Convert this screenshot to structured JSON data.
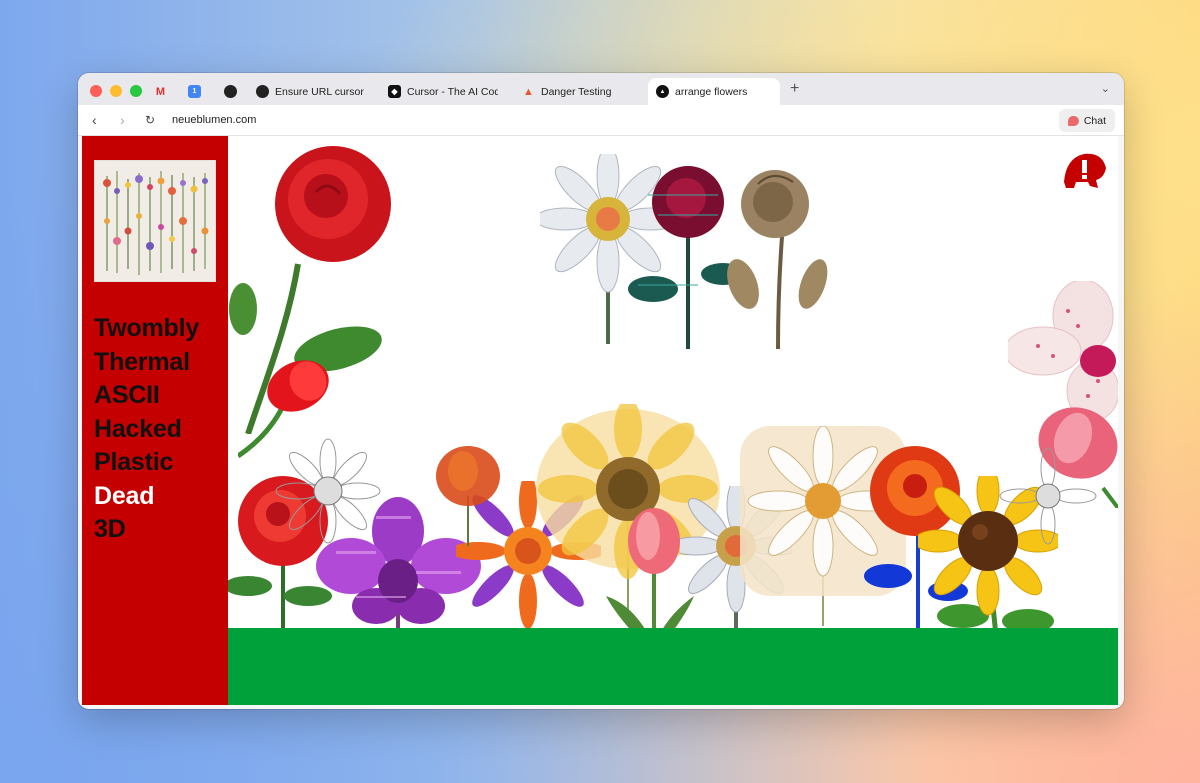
{
  "browser": {
    "tabs": [
      {
        "title": "",
        "favicon": "gmail-icon"
      },
      {
        "title": "",
        "favicon": "calendar-icon"
      },
      {
        "title": "",
        "favicon": "github-icon"
      },
      {
        "title": "Ensure URL cursor stay",
        "favicon": "github-icon"
      },
      {
        "title": "Cursor - The AI Code E",
        "favicon": "cursor-icon"
      },
      {
        "title": "Danger Testing",
        "favicon": "danger-icon"
      },
      {
        "title": "arrange flowers",
        "favicon": "triangle-icon",
        "active": true
      }
    ],
    "new_tab": "+",
    "tab_menu": "⌄",
    "url": "neueblumen.com",
    "chat_label": "Chat"
  },
  "page": {
    "menu": [
      {
        "label": "Twombly"
      },
      {
        "label": "Thermal"
      },
      {
        "label": "ASCII"
      },
      {
        "label": "Hacked"
      },
      {
        "label": "Plastic"
      },
      {
        "label": "Dead",
        "active": true
      },
      {
        "label": "3D"
      }
    ],
    "colors": {
      "sidebar": "#c40000",
      "grass": "#00a13a",
      "active_menu": "#ffffff"
    }
  }
}
